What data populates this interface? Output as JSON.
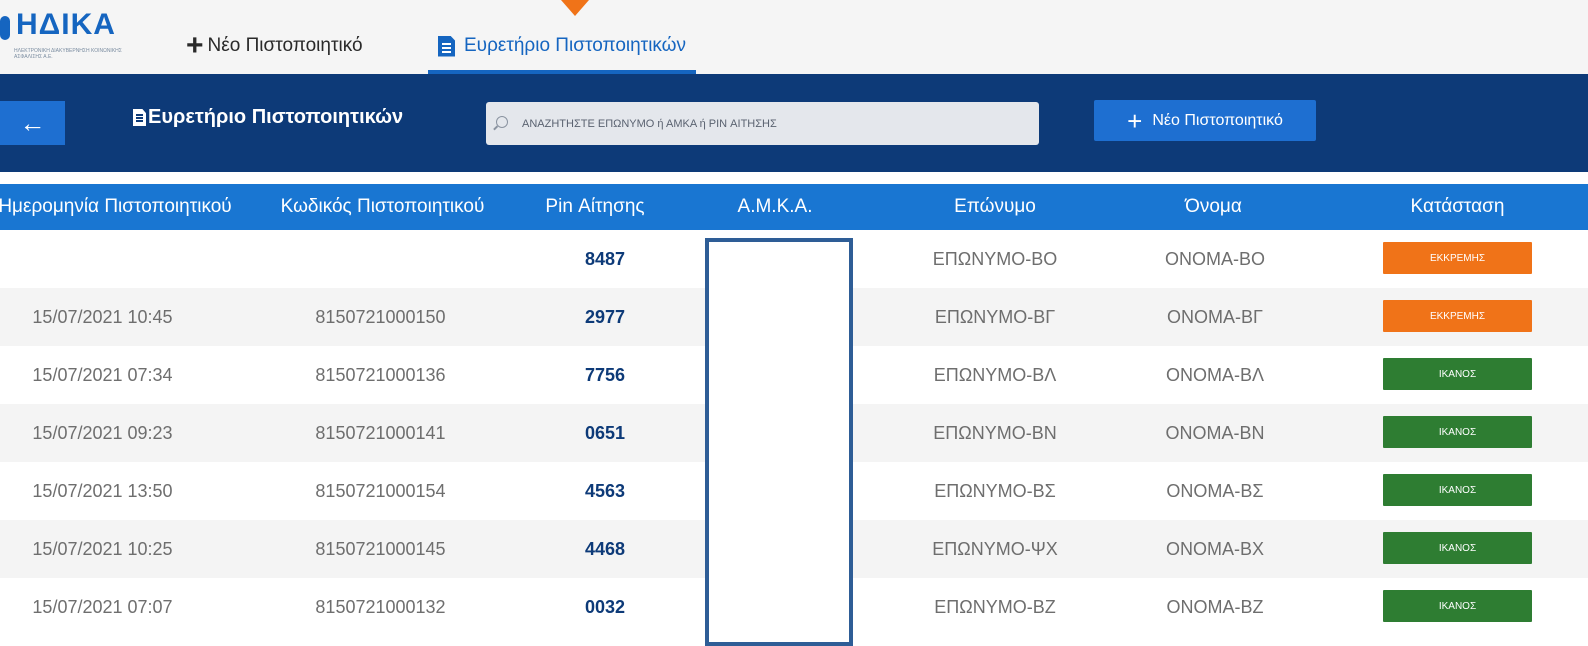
{
  "brand": {
    "name": "ΗΔΙΚΑ",
    "tagline": "ΗΛΕΚΤΡΟΝΙΚΗ ΔΙΑΚΥΒΕΡΝΗΣΗ ΚΟΙΝΩΝΙΚΗΣ ΑΣΦΑΛΙΣΗΣ Α.Ε."
  },
  "nav": {
    "new_tab": {
      "icon": "plus-icon",
      "label": "Νέο Πιστοποιητικό"
    },
    "index_tab": {
      "icon": "document-icon",
      "label": "Ευρετήριο Πιστοποιητικών"
    }
  },
  "toolbar": {
    "back_icon": "←",
    "title": "Ευρετήριο Πιστοποιητικών",
    "search_placeholder": "ΑΝΑΖΗΤΗΣΤΕ ΕΠΩΝΥΜΟ ή ΑΜΚΑ ή PIN ΑΙΤΗΣΗΣ",
    "new_button": {
      "plus": "+",
      "label": "Νέο Πιστοποιητικό"
    }
  },
  "table": {
    "columns": [
      "Ημερομηνία Πιστοποιητικού",
      "Κωδικός Πιστοποιητικού",
      "Pin Αίτησης",
      "Α.Μ.Κ.Α.",
      "Επώνυμο",
      "Όνομα",
      "Κατάσταση"
    ],
    "rows": [
      {
        "date": "",
        "code": "",
        "pin": "8487",
        "amka": "",
        "surname": "ΕΠΩΝΥΜΟ-ΒΟ",
        "name": "ONOMA-BO",
        "status": "ΕΚΚΡΕΜΗΣ"
      },
      {
        "date": "15/07/2021 10:45",
        "code": "8150721000150",
        "pin": "2977",
        "amka": "",
        "surname": "ΕΠΩΝΥΜΟ-ΒΓ",
        "name": "ONOMA-ΒΓ",
        "status": "ΕΚΚΡΕΜΗΣ"
      },
      {
        "date": "15/07/2021 07:34",
        "code": "8150721000136",
        "pin": "7756",
        "amka": "",
        "surname": "ΕΠΩΝΥΜΟ-ΒΛ",
        "name": "ONOMA-ΒΛ",
        "status": "ΙΚΑΝΟΣ"
      },
      {
        "date": "15/07/2021 09:23",
        "code": "8150721000141",
        "pin": "0651",
        "amka": "",
        "surname": "ΕΠΩΝΥΜΟ-ΒΝ",
        "name": "ONOMA-BN",
        "status": "ΙΚΑΝΟΣ"
      },
      {
        "date": "15/07/2021 13:50",
        "code": "8150721000154",
        "pin": "4563",
        "amka": "",
        "surname": "ΕΠΩΝΥΜΟ-ΒΣ",
        "name": "ONOMA-ΒΣ",
        "status": "ΙΚΑΝΟΣ"
      },
      {
        "date": "15/07/2021 10:25",
        "code": "8150721000145",
        "pin": "4468",
        "amka": "",
        "surname": "ΕΠΩΝΥΜΟ-ΨΧ",
        "name": "ONOMA-BX",
        "status": "ΙΚΑΝΟΣ"
      },
      {
        "date": "15/07/2021 07:07",
        "code": "8150721000132",
        "pin": "0032",
        "amka": "",
        "surname": "ΕΠΩΝΥΜΟ-ΒΖ",
        "name": "ONOMA-BZ",
        "status": "ΙΚΑΝΟΣ"
      }
    ]
  },
  "colors": {
    "brand_blue": "#1565c0",
    "toolbar_bg": "#0d3a78",
    "header_bg": "#1976d2",
    "status_pending": "#f07318",
    "status_ok": "#2e7d32",
    "pointer": "#f07318",
    "amka_redaction": "#2e5d96"
  }
}
